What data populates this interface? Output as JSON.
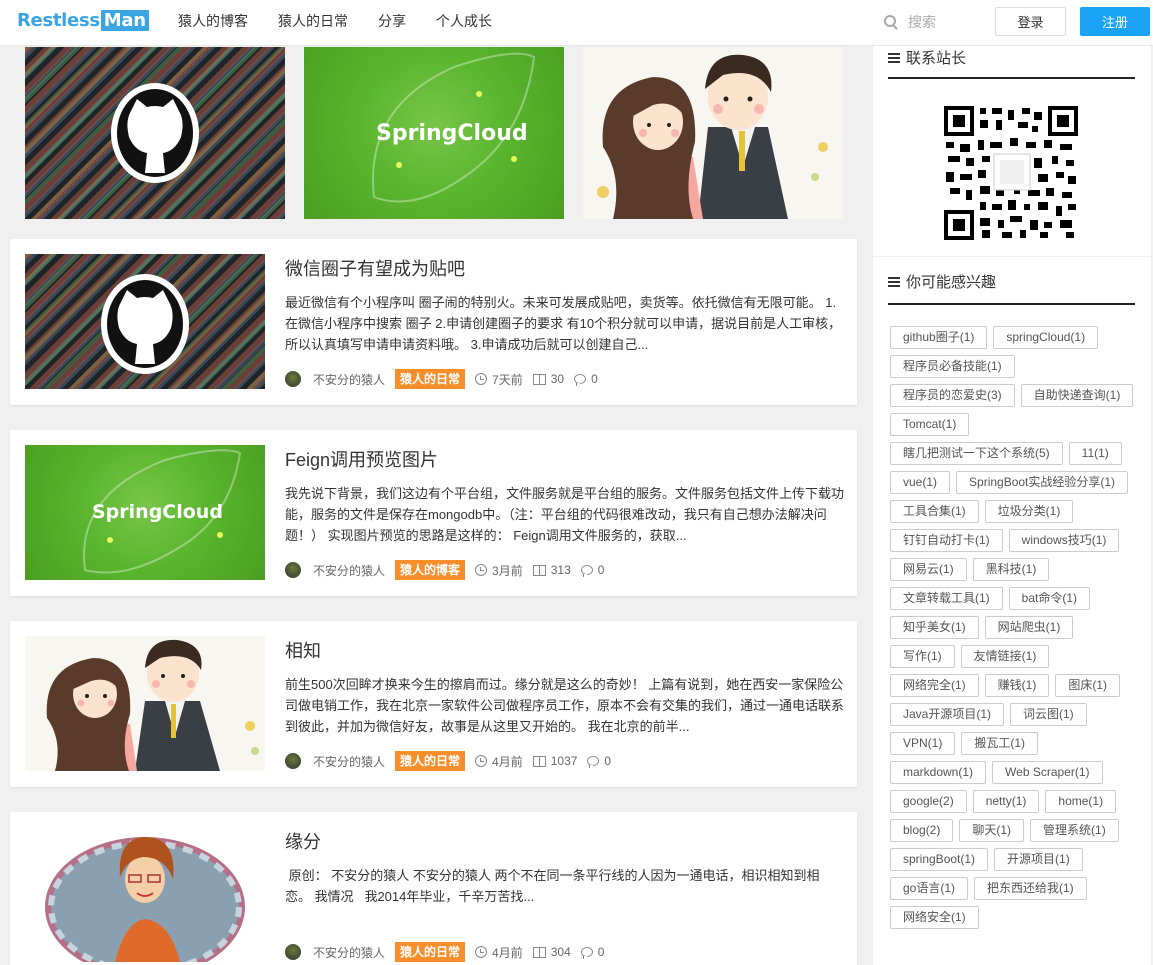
{
  "header": {
    "logo_part1": "Restless",
    "logo_part2": "Man",
    "nav": [
      "猿人的博客",
      "猿人的日常",
      "分享",
      "个人成长"
    ],
    "search_placeholder": "搜索",
    "login": "登录",
    "register": "注册"
  },
  "banner": {
    "items": [
      {
        "type": "github"
      },
      {
        "type": "springcloud",
        "text": "SpringCloud"
      },
      {
        "type": "couple"
      }
    ]
  },
  "posts": [
    {
      "title": "微信圈子有望成为贴吧",
      "desc": "最近微信有个小程序叫 圈子闹的特别火。未来可发展成贴吧，卖货等。依托微信有无限可能。 1.在微信小程序中搜索 圈子 2.申请创建圈子的要求 有10个积分就可以申请，据说目前是人工审核，所以认真填写申请申请资料哦。 3.申请成功后就可以创建自己...",
      "author": "不安分的猿人",
      "category": "猿人的日常",
      "time": "7天前",
      "views": "30",
      "comments": "0",
      "thumb": "github"
    },
    {
      "title": "Feign调用预览图片",
      "desc": "我先说下背景，我们这边有个平台组，文件服务就是平台组的服务。文件服务包括文件上传下载功能，服务的文件是保存在mongodb中。（注：平台组的代码很难改动，我只有自己想办法解决问题！） 实现图片预览的思路是这样的： Feign调用文件服务的，获取...",
      "author": "不安分的猿人",
      "category": "猿人的博客",
      "time": "3月前",
      "views": "313",
      "comments": "0",
      "thumb": "springcloud",
      "thumb_text": "SpringCloud"
    },
    {
      "title": "相知",
      "desc": "前生500次回眸才换来今生的擦肩而过。缘分就是这么的奇妙！ 上篇有说到，她在西安一家保险公司做电销工作，我在北京一家软件公司做程序员工作，原本不会有交集的我们，通过一通电话联系到彼此，并加为微信好友，故事是从这里又开始的。 我在北京的前半...",
      "author": "不安分的猿人",
      "category": "猿人的日常",
      "time": "4月前",
      "views": "1037",
      "comments": "0",
      "thumb": "couple"
    },
    {
      "title": "缘分",
      "desc": " 原创： 不安分的猿人 不安分的猿人 两个不在同一条平行线的人因为一通电话，相识相知到相恋。 我情况   我2014年毕业，千辛万苦找...",
      "author": "不安分的猿人",
      "category": "猿人的日常",
      "time": "4月前",
      "views": "304",
      "comments": "0",
      "thumb": "woman"
    }
  ],
  "sidebar": {
    "contact_title": "联系站长",
    "interest_title": "你可能感兴趣",
    "tags": [
      "github圈子(1)",
      "springCloud(1)",
      "程序员必备技能(1)",
      "程序员的恋爱史(3)",
      "自助快递查询(1)",
      "Tomcat(1)",
      "瞎几把测试一下这个系统(5)",
      "11(1)",
      "vue(1)",
      "SpringBoot实战经验分享(1)",
      "工具合集(1)",
      "垃圾分类(1)",
      "钉钉自动打卡(1)",
      "windows技巧(1)",
      "网易云(1)",
      "黑科技(1)",
      "文章转载工具(1)",
      "bat命令(1)",
      "知乎美女(1)",
      "网站爬虫(1)",
      "写作(1)",
      "友情链接(1)",
      "网络完全(1)",
      "赚钱(1)",
      "图床(1)",
      "Java开源项目(1)",
      "词云图(1)",
      "VPN(1)",
      "搬瓦工(1)",
      "markdown(1)",
      "Web Scraper(1)",
      "google(2)",
      "netty(1)",
      "home(1)",
      "blog(2)",
      "聊天(1)",
      "管理系统(1)",
      "springBoot(1)",
      "开源项目(1)",
      "go语言(1)",
      "把东西还给我(1)",
      "网络安全(1)"
    ]
  },
  "colors": {
    "accent": "#1aa3f5",
    "logo": "#3aa5e0",
    "badge": "#f78e2a"
  }
}
